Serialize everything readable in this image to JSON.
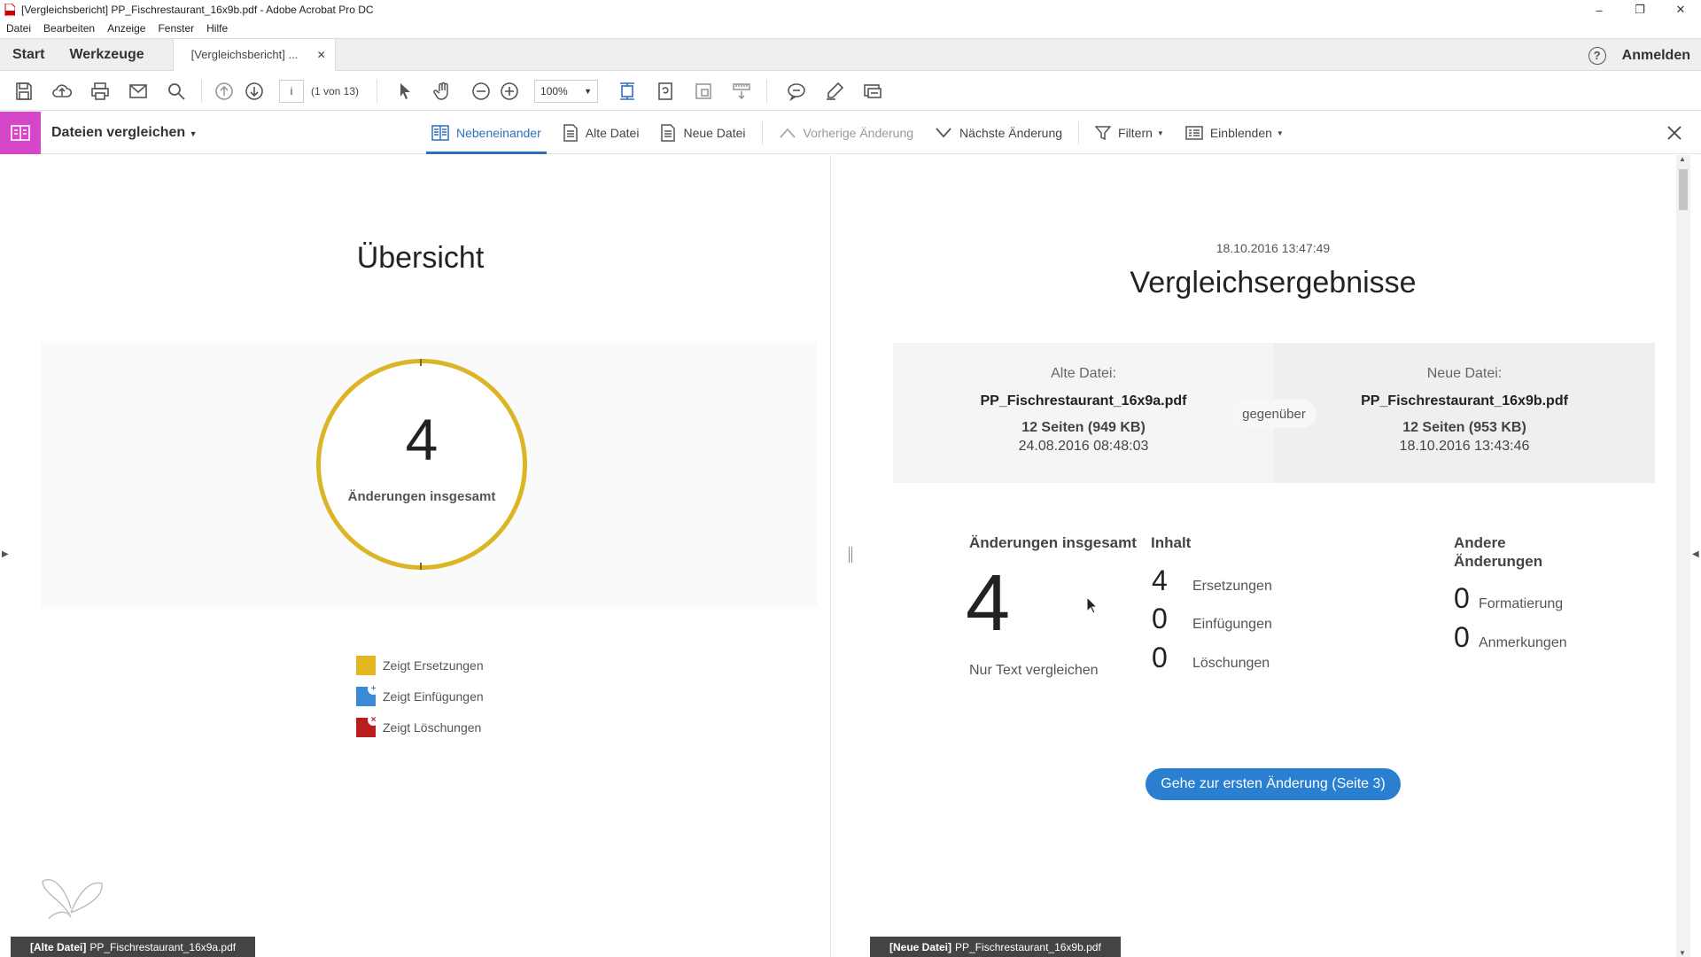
{
  "window": {
    "title": "[Vergleichsbericht] PP_Fischrestaurant_16x9b.pdf - Adobe Acrobat Pro DC"
  },
  "menu": [
    "Datei",
    "Bearbeiten",
    "Anzeige",
    "Fenster",
    "Hilfe"
  ],
  "tabs": {
    "start": "Start",
    "tools": "Werkzeuge",
    "document": "[Vergleichsbericht] ...",
    "signin": "Anmelden"
  },
  "toolbar": {
    "page_input": "i",
    "page_of": "(1 von 13)",
    "zoom": "100%"
  },
  "compare": {
    "title": "Dateien vergleichen",
    "side_by_side": "Nebeneinander",
    "old_file": "Alte Datei",
    "new_file": "Neue Datei",
    "prev_change": "Vorherige Änderung",
    "next_change": "Nächste Änderung",
    "filter": "Filtern",
    "show": "Einblenden"
  },
  "overview": {
    "title": "Übersicht",
    "total": "4",
    "total_label": "Änderungen insgesamt",
    "legend": {
      "replacements": "Zeigt Ersetzungen",
      "insertions": "Zeigt Einfügungen",
      "deletions": "Zeigt Löschungen"
    },
    "file_tag_prefix": "[Alte Datei]",
    "file_tag_name": "PP_Fischrestaurant_16x9a.pdf"
  },
  "results": {
    "date": "18.10.2016 13:47:49",
    "title": "Vergleichsergebnisse",
    "old": {
      "label": "Alte Datei:",
      "name": "PP_Fischrestaurant_16x9a.pdf",
      "pages": "12 Seiten (949 KB)",
      "date": "24.08.2016 08:48:03"
    },
    "versus": "gegenüber",
    "new": {
      "label": "Neue Datei:",
      "name": "PP_Fischrestaurant_16x9b.pdf",
      "pages": "12 Seiten (953 KB)",
      "date": "18.10.2016 13:43:46"
    },
    "total_heading": "Änderungen insgesamt",
    "total": "4",
    "text_only": "Nur Text vergleichen",
    "content_heading": "Inhalt",
    "content": [
      {
        "num": "4",
        "label": "Ersetzungen"
      },
      {
        "num": "0",
        "label": "Einfügungen"
      },
      {
        "num": "0",
        "label": "Löschungen"
      }
    ],
    "other_heading_1": "Andere",
    "other_heading_2": "Änderungen",
    "other": [
      {
        "num": "0",
        "label": "Formatierung"
      },
      {
        "num": "0",
        "label": "Anmerkungen"
      }
    ],
    "goto_button": "Gehe zur ersten Änderung (Seite 3)",
    "file_tag_prefix": "[Neue Datei]",
    "file_tag_name": "PP_Fischrestaurant_16x9b.pdf"
  },
  "colors": {
    "accent_blue": "#2b7fd1",
    "ring_yellow": "#dbb525",
    "compare_magenta": "#d646c9",
    "delete_red": "#b91d1d",
    "insert_blue": "#3a8ad8"
  }
}
